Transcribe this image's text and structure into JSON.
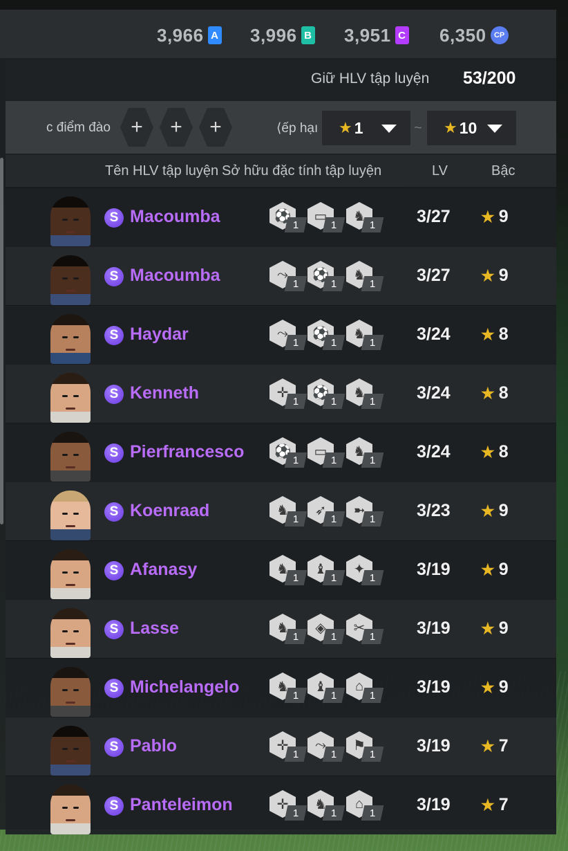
{
  "currencies": [
    {
      "value": "3,966",
      "badge": "A",
      "color": "#2f8bff"
    },
    {
      "value": "3,996",
      "badge": "B",
      "color": "#1fbfa6"
    },
    {
      "value": "3,951",
      "badge": "C",
      "color": "#b43cff"
    },
    {
      "value": "6,350",
      "badge": "CP",
      "color": "#5a7df2"
    }
  ],
  "keep": {
    "label": "Giữ HLV tập luyện",
    "count": "53/200"
  },
  "filter": {
    "points_label": "c điểm đào",
    "add_buttons": [
      "+",
      "+",
      "+"
    ],
    "rank_label": "⟨ếp hạı",
    "rank_from": "1",
    "rank_to": "10",
    "separator": "~"
  },
  "columns": {
    "name": "Tên HLV tập luyện",
    "traits": "Sở hữu đặc tính tập luyện",
    "lv": "LV",
    "grade": "Bậc"
  },
  "rows": [
    {
      "name": "Macoumba",
      "tier": "S",
      "lv": "3/27",
      "grade": "9",
      "skin": "dark",
      "traits": [
        {
          "icon": "goalkeeper-ball-icon",
          "level": "1"
        },
        {
          "icon": "goal-net-icon",
          "level": "1"
        },
        {
          "icon": "defender-stance-icon",
          "level": "1"
        }
      ]
    },
    {
      "name": "Macoumba",
      "tier": "S",
      "lv": "3/27",
      "grade": "9",
      "skin": "dark",
      "traits": [
        {
          "icon": "slide-tackle-icon",
          "level": "1"
        },
        {
          "icon": "goalkeeper-ball-icon",
          "level": "1"
        },
        {
          "icon": "defender-stance-icon",
          "level": "1"
        }
      ]
    },
    {
      "name": "Haydar",
      "tier": "S",
      "lv": "3/24",
      "grade": "8",
      "skin": "tan",
      "traits": [
        {
          "icon": "slide-tackle-icon",
          "level": "1"
        },
        {
          "icon": "goalkeeper-ball-icon",
          "level": "1"
        },
        {
          "icon": "defender-stance-icon",
          "level": "1"
        }
      ]
    },
    {
      "name": "Kenneth",
      "tier": "S",
      "lv": "3/24",
      "grade": "8",
      "skin": "light",
      "traits": [
        {
          "icon": "crosshair-icon",
          "level": "1"
        },
        {
          "icon": "goalkeeper-ball-icon",
          "level": "1"
        },
        {
          "icon": "defender-stance-icon",
          "level": "1"
        }
      ]
    },
    {
      "name": "Pierfrancesco",
      "tier": "S",
      "lv": "3/24",
      "grade": "8",
      "skin": "normal",
      "traits": [
        {
          "icon": "goalkeeper-ball-icon",
          "level": "1"
        },
        {
          "icon": "goal-net-icon",
          "level": "1"
        },
        {
          "icon": "defender-stance-icon",
          "level": "1"
        }
      ]
    },
    {
      "name": "Koenraad",
      "tier": "S",
      "lv": "3/23",
      "grade": "9",
      "skin": "blond",
      "traits": [
        {
          "icon": "defender-stance-icon",
          "level": "1"
        },
        {
          "icon": "sprint-icon",
          "level": "1"
        },
        {
          "icon": "shot-power-icon",
          "level": "1"
        }
      ]
    },
    {
      "name": "Afanasy",
      "tier": "S",
      "lv": "3/19",
      "grade": "9",
      "skin": "light",
      "traits": [
        {
          "icon": "defender-stance-icon",
          "level": "1"
        },
        {
          "icon": "balance-icon",
          "level": "1"
        },
        {
          "icon": "dribble-icon",
          "level": "1"
        }
      ]
    },
    {
      "name": "Lasse",
      "tier": "S",
      "lv": "3/19",
      "grade": "9",
      "skin": "light",
      "traits": [
        {
          "icon": "defender-stance-icon",
          "level": "1"
        },
        {
          "icon": "shield-icon",
          "level": "1"
        },
        {
          "icon": "scissors-icon",
          "level": "1"
        }
      ]
    },
    {
      "name": "Michelangelo",
      "tier": "S",
      "lv": "3/19",
      "grade": "9",
      "skin": "normal",
      "traits": [
        {
          "icon": "defender-stance-icon",
          "level": "1"
        },
        {
          "icon": "balance-icon",
          "level": "1"
        },
        {
          "icon": "lock-icon",
          "level": "1"
        }
      ]
    },
    {
      "name": "Pablo",
      "tier": "S",
      "lv": "3/19",
      "grade": "7",
      "skin": "dark",
      "traits": [
        {
          "icon": "crosshair-icon",
          "level": "1"
        },
        {
          "icon": "slide-tackle-icon",
          "level": "1"
        },
        {
          "icon": "header-icon",
          "level": "1"
        }
      ]
    },
    {
      "name": "Panteleimon",
      "tier": "S",
      "lv": "3/19",
      "grade": "7",
      "skin": "light",
      "traits": [
        {
          "icon": "crosshair-icon",
          "level": "1"
        },
        {
          "icon": "defender-stance-icon",
          "level": "1"
        },
        {
          "icon": "lock-icon",
          "level": "1"
        }
      ]
    }
  ]
}
